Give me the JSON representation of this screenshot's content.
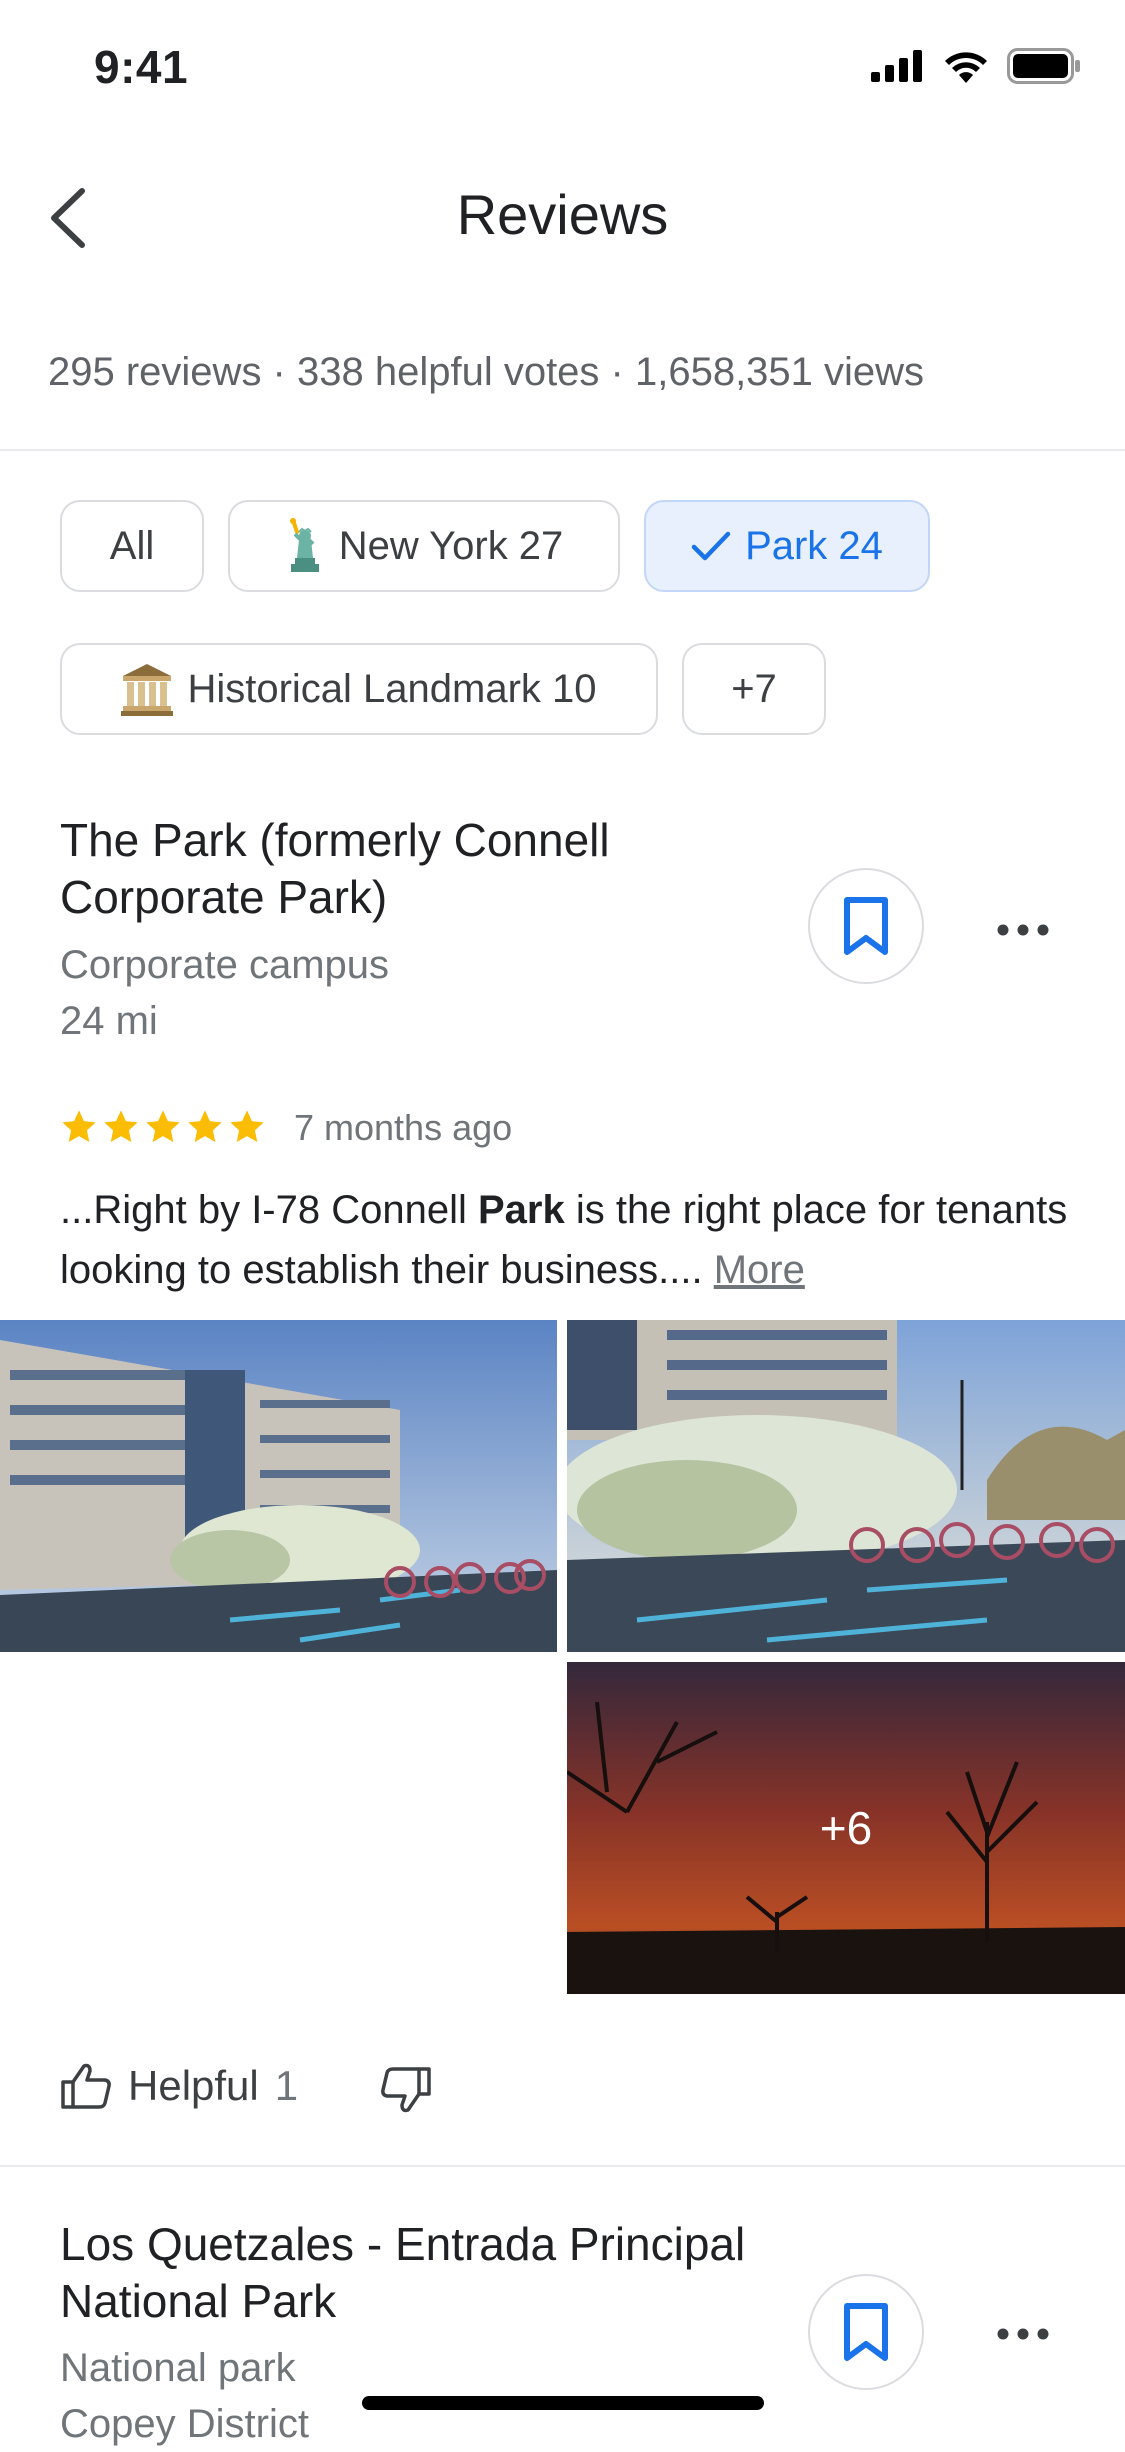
{
  "status_bar": {
    "time": "9:41"
  },
  "header": {
    "title": "Reviews"
  },
  "stats": {
    "text": "295 reviews · 338 helpful votes · 1,658,351 views"
  },
  "chips": [
    {
      "label": "All"
    },
    {
      "label": "New York 27",
      "icon": "statue-of-liberty-icon"
    },
    {
      "label": "Park 24",
      "icon": "check-icon",
      "selected": true
    },
    {
      "label": "Historical Landmark 10",
      "icon": "classical-building-icon"
    },
    {
      "label": "+7"
    }
  ],
  "reviews": [
    {
      "place_title": "The Park (formerly Connell Corporate Park)",
      "category": "Corporate campus",
      "distance": "24 mi",
      "rating": 5,
      "date": "7 months ago",
      "text_before": "...Right by I-78 Connell ",
      "text_bold": "Park",
      "text_after": " is the right place for tenants looking to establish their business.... ",
      "more_label": "More",
      "photos_more_label": "+6",
      "helpful_label": "Helpful",
      "helpful_count": "1"
    },
    {
      "place_title": "Los Quetzales - Entrada Principal National Park",
      "category": "National park",
      "location": "Copey District"
    }
  ],
  "colors": {
    "accent": "#1a73e8",
    "star": "#fbbc04",
    "chip_selected_bg": "#e8f0fe"
  }
}
